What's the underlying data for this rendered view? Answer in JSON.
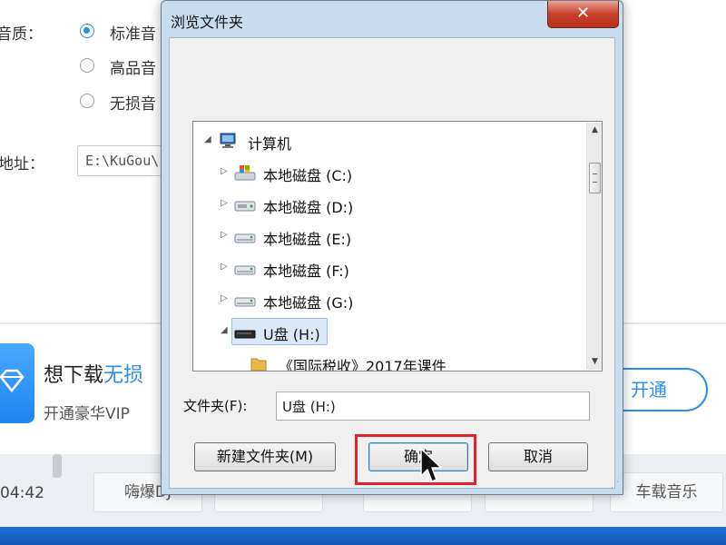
{
  "background": {
    "quality_label": "音质：",
    "quality_options": [
      {
        "label": "标准音",
        "checked": true
      },
      {
        "label": "高品音",
        "checked": false
      },
      {
        "label": "无损音",
        "checked": false
      }
    ],
    "address_label": "地址：",
    "address_value": "E:\\KuGou\\",
    "promo_title_prefix": "想下载",
    "promo_title_highlight": "无损",
    "promo_subtitle": "开通豪华VIP",
    "open_button": "开通",
    "time": "04:42",
    "chips": [
      "嗨爆DJ",
      "",
      "",
      "",
      "车载音乐"
    ]
  },
  "dialog": {
    "title": "浏览文件夹",
    "close_glyph": "✕",
    "tree": [
      {
        "label": "计算机",
        "icon": "computer-icon",
        "expanded": true
      },
      {
        "label": "本地磁盘 (C:)",
        "icon": "system-drive-icon",
        "expanded": false
      },
      {
        "label": "本地磁盘 (D:)",
        "icon": "drive-icon",
        "expanded": false
      },
      {
        "label": "本地磁盘 (E:)",
        "icon": "drive-icon",
        "expanded": false
      },
      {
        "label": "本地磁盘 (F:)",
        "icon": "drive-icon",
        "expanded": false
      },
      {
        "label": "本地磁盘 (G:)",
        "icon": "drive-icon",
        "expanded": false
      },
      {
        "label": "U盘 (H:)",
        "icon": "usb-drive-icon",
        "expanded": true,
        "selected": true
      },
      {
        "label": "《国际税收》2017年课件",
        "icon": "folder-icon",
        "expanded": false
      }
    ],
    "folder_label": "文件夹(F):",
    "folder_value": "U盘 (H:)",
    "new_folder_button": "新建文件夹(M)",
    "ok_button": "确定",
    "cancel_button": "取消"
  },
  "colors": {
    "accent": "#2a8ef0",
    "highlight_box": "#e0242b",
    "dialog_frame": "#c9dced"
  }
}
